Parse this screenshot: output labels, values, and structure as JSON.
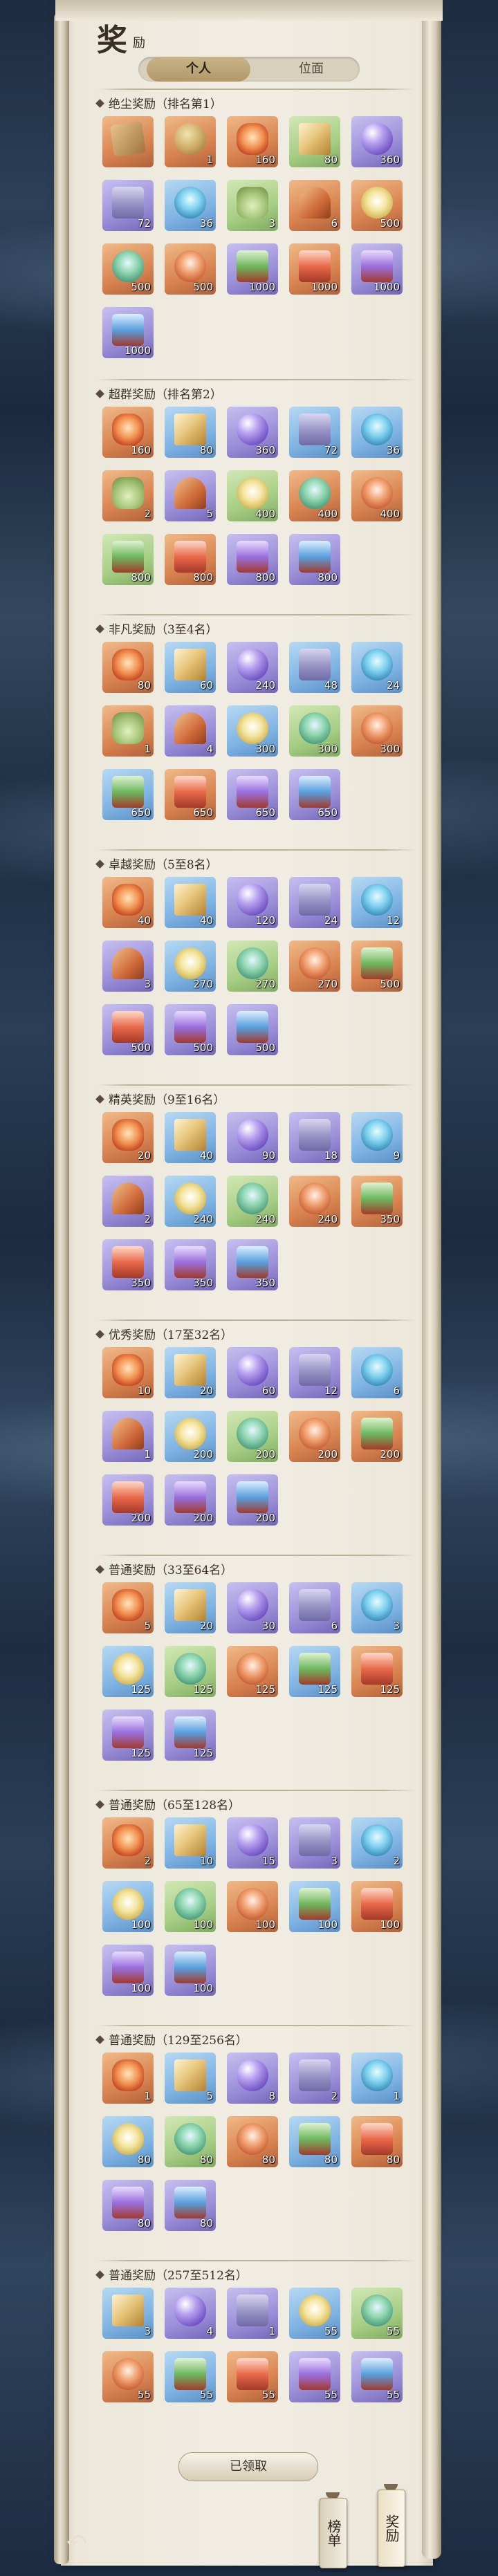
{
  "header": {
    "title": "奖",
    "subtitle": "励"
  },
  "tabs": [
    {
      "label": "个人"
    },
    {
      "label": "位面"
    }
  ],
  "sections": [
    {
      "title": "绝尘奖励（排名第1）",
      "items": [
        {
          "q": "",
          "icon": "i-tome",
          "c": "orange"
        },
        {
          "q": "1",
          "icon": "i-urn",
          "c": "orange"
        },
        {
          "q": "160",
          "icon": "i-flower",
          "c": "orange"
        },
        {
          "q": "80",
          "icon": "i-book",
          "c": "green"
        },
        {
          "q": "360",
          "icon": "i-orb",
          "c": "purple"
        },
        {
          "q": "72",
          "icon": "i-chest",
          "c": "purple"
        },
        {
          "q": "36",
          "icon": "i-bluefire",
          "c": "blue"
        },
        {
          "q": "3",
          "icon": "i-hat",
          "c": "green"
        },
        {
          "q": "6",
          "icon": "i-fan",
          "c": "orange"
        },
        {
          "q": "500",
          "icon": "i-silkgold",
          "c": "orange"
        },
        {
          "q": "500",
          "icon": "i-bowlgreen",
          "c": "orange"
        },
        {
          "q": "500",
          "icon": "i-bowlred",
          "c": "orange"
        },
        {
          "q": "1000",
          "icon": "i-boxgreen",
          "c": "purple"
        },
        {
          "q": "1000",
          "icon": "i-boxred",
          "c": "orange"
        },
        {
          "q": "1000",
          "icon": "i-boxpurple",
          "c": "purple"
        },
        {
          "q": "1000",
          "icon": "i-boxblue",
          "c": "purple"
        }
      ]
    },
    {
      "title": "超群奖励（排名第2）",
      "items": [
        {
          "q": "160",
          "icon": "i-flower",
          "c": "orange"
        },
        {
          "q": "80",
          "icon": "i-book",
          "c": "blue"
        },
        {
          "q": "360",
          "icon": "i-orb",
          "c": "purple"
        },
        {
          "q": "72",
          "icon": "i-chest",
          "c": "blue"
        },
        {
          "q": "36",
          "icon": "i-bluefire",
          "c": "blue"
        },
        {
          "q": "2",
          "icon": "i-hat",
          "c": "orange"
        },
        {
          "q": "5",
          "icon": "i-fan",
          "c": "purple"
        },
        {
          "q": "400",
          "icon": "i-silkgold",
          "c": "green"
        },
        {
          "q": "400",
          "icon": "i-bowlgreen",
          "c": "orange"
        },
        {
          "q": "400",
          "icon": "i-bowlred",
          "c": "orange"
        },
        {
          "q": "800",
          "icon": "i-boxgreen",
          "c": "green"
        },
        {
          "q": "800",
          "icon": "i-boxred",
          "c": "orange"
        },
        {
          "q": "800",
          "icon": "i-boxpurple",
          "c": "purple"
        },
        {
          "q": "800",
          "icon": "i-boxblue",
          "c": "purple"
        }
      ]
    },
    {
      "title": "非凡奖励（3至4名）",
      "items": [
        {
          "q": "80",
          "icon": "i-flower",
          "c": "orange"
        },
        {
          "q": "60",
          "icon": "i-book",
          "c": "blue"
        },
        {
          "q": "240",
          "icon": "i-orb",
          "c": "purple"
        },
        {
          "q": "48",
          "icon": "i-chest",
          "c": "blue"
        },
        {
          "q": "24",
          "icon": "i-bluefire",
          "c": "blue"
        },
        {
          "q": "1",
          "icon": "i-hat",
          "c": "orange"
        },
        {
          "q": "4",
          "icon": "i-fan",
          "c": "purple"
        },
        {
          "q": "300",
          "icon": "i-silkgold",
          "c": "blue"
        },
        {
          "q": "300",
          "icon": "i-bowlgreen",
          "c": "green"
        },
        {
          "q": "300",
          "icon": "i-bowlred",
          "c": "orange"
        },
        {
          "q": "650",
          "icon": "i-boxgreen",
          "c": "blue"
        },
        {
          "q": "650",
          "icon": "i-boxred",
          "c": "orange"
        },
        {
          "q": "650",
          "icon": "i-boxpurple",
          "c": "purple"
        },
        {
          "q": "650",
          "icon": "i-boxblue",
          "c": "purple"
        }
      ]
    },
    {
      "title": "卓越奖励（5至8名）",
      "items": [
        {
          "q": "40",
          "icon": "i-flower",
          "c": "orange"
        },
        {
          "q": "40",
          "icon": "i-book",
          "c": "blue"
        },
        {
          "q": "120",
          "icon": "i-orb",
          "c": "purple"
        },
        {
          "q": "24",
          "icon": "i-chest",
          "c": "purple"
        },
        {
          "q": "12",
          "icon": "i-bluefire",
          "c": "blue"
        },
        {
          "q": "3",
          "icon": "i-fan",
          "c": "purple"
        },
        {
          "q": "270",
          "icon": "i-silkgold",
          "c": "blue"
        },
        {
          "q": "270",
          "icon": "i-bowlgreen",
          "c": "green"
        },
        {
          "q": "270",
          "icon": "i-bowlred",
          "c": "orange"
        },
        {
          "q": "500",
          "icon": "i-boxgreen",
          "c": "orange"
        },
        {
          "q": "500",
          "icon": "i-boxred",
          "c": "purple"
        },
        {
          "q": "500",
          "icon": "i-boxpurple",
          "c": "purple"
        },
        {
          "q": "500",
          "icon": "i-boxblue",
          "c": "purple"
        }
      ]
    },
    {
      "title": "精英奖励（9至16名）",
      "items": [
        {
          "q": "20",
          "icon": "i-flower",
          "c": "orange"
        },
        {
          "q": "40",
          "icon": "i-book",
          "c": "blue"
        },
        {
          "q": "90",
          "icon": "i-orb",
          "c": "purple"
        },
        {
          "q": "18",
          "icon": "i-chest",
          "c": "purple"
        },
        {
          "q": "9",
          "icon": "i-bluefire",
          "c": "blue"
        },
        {
          "q": "2",
          "icon": "i-fan",
          "c": "purple"
        },
        {
          "q": "240",
          "icon": "i-silkgold",
          "c": "blue"
        },
        {
          "q": "240",
          "icon": "i-bowlgreen",
          "c": "green"
        },
        {
          "q": "240",
          "icon": "i-bowlred",
          "c": "orange"
        },
        {
          "q": "350",
          "icon": "i-boxgreen",
          "c": "orange"
        },
        {
          "q": "350",
          "icon": "i-boxred",
          "c": "purple"
        },
        {
          "q": "350",
          "icon": "i-boxpurple",
          "c": "purple"
        },
        {
          "q": "350",
          "icon": "i-boxblue",
          "c": "purple"
        }
      ]
    },
    {
      "title": "优秀奖励（17至32名）",
      "items": [
        {
          "q": "10",
          "icon": "i-flower",
          "c": "orange"
        },
        {
          "q": "20",
          "icon": "i-book",
          "c": "blue"
        },
        {
          "q": "60",
          "icon": "i-orb",
          "c": "purple"
        },
        {
          "q": "12",
          "icon": "i-chest",
          "c": "purple"
        },
        {
          "q": "6",
          "icon": "i-bluefire",
          "c": "blue"
        },
        {
          "q": "1",
          "icon": "i-fan",
          "c": "purple"
        },
        {
          "q": "200",
          "icon": "i-silkgold",
          "c": "blue"
        },
        {
          "q": "200",
          "icon": "i-bowlgreen",
          "c": "green"
        },
        {
          "q": "200",
          "icon": "i-bowlred",
          "c": "orange"
        },
        {
          "q": "200",
          "icon": "i-boxgreen",
          "c": "orange"
        },
        {
          "q": "200",
          "icon": "i-boxred",
          "c": "purple"
        },
        {
          "q": "200",
          "icon": "i-boxpurple",
          "c": "purple"
        },
        {
          "q": "200",
          "icon": "i-boxblue",
          "c": "purple"
        }
      ]
    },
    {
      "title": "普通奖励（33至64名）",
      "items": [
        {
          "q": "5",
          "icon": "i-flower",
          "c": "orange"
        },
        {
          "q": "20",
          "icon": "i-book",
          "c": "blue"
        },
        {
          "q": "30",
          "icon": "i-orb",
          "c": "purple"
        },
        {
          "q": "6",
          "icon": "i-chest",
          "c": "purple"
        },
        {
          "q": "3",
          "icon": "i-bluefire",
          "c": "blue"
        },
        {
          "q": "125",
          "icon": "i-silkgold",
          "c": "blue"
        },
        {
          "q": "125",
          "icon": "i-bowlgreen",
          "c": "green"
        },
        {
          "q": "125",
          "icon": "i-bowlred",
          "c": "orange"
        },
        {
          "q": "125",
          "icon": "i-boxgreen",
          "c": "blue"
        },
        {
          "q": "125",
          "icon": "i-boxred",
          "c": "orange"
        },
        {
          "q": "125",
          "icon": "i-boxpurple",
          "c": "purple"
        },
        {
          "q": "125",
          "icon": "i-boxblue",
          "c": "purple"
        }
      ]
    },
    {
      "title": "普通奖励（65至128名）",
      "items": [
        {
          "q": "2",
          "icon": "i-flower",
          "c": "orange"
        },
        {
          "q": "10",
          "icon": "i-book",
          "c": "blue"
        },
        {
          "q": "15",
          "icon": "i-orb",
          "c": "purple"
        },
        {
          "q": "3",
          "icon": "i-chest",
          "c": "purple"
        },
        {
          "q": "2",
          "icon": "i-bluefire",
          "c": "blue"
        },
        {
          "q": "100",
          "icon": "i-silkgold",
          "c": "blue"
        },
        {
          "q": "100",
          "icon": "i-bowlgreen",
          "c": "green"
        },
        {
          "q": "100",
          "icon": "i-bowlred",
          "c": "orange"
        },
        {
          "q": "100",
          "icon": "i-boxgreen",
          "c": "blue"
        },
        {
          "q": "100",
          "icon": "i-boxred",
          "c": "orange"
        },
        {
          "q": "100",
          "icon": "i-boxpurple",
          "c": "purple"
        },
        {
          "q": "100",
          "icon": "i-boxblue",
          "c": "purple"
        }
      ]
    },
    {
      "title": "普通奖励（129至256名）",
      "items": [
        {
          "q": "1",
          "icon": "i-flower",
          "c": "orange"
        },
        {
          "q": "5",
          "icon": "i-book",
          "c": "blue"
        },
        {
          "q": "8",
          "icon": "i-orb",
          "c": "purple"
        },
        {
          "q": "2",
          "icon": "i-chest",
          "c": "purple"
        },
        {
          "q": "1",
          "icon": "i-bluefire",
          "c": "blue"
        },
        {
          "q": "80",
          "icon": "i-silkgold",
          "c": "blue"
        },
        {
          "q": "80",
          "icon": "i-bowlgreen",
          "c": "green"
        },
        {
          "q": "80",
          "icon": "i-bowlred",
          "c": "orange"
        },
        {
          "q": "80",
          "icon": "i-boxgreen",
          "c": "blue"
        },
        {
          "q": "80",
          "icon": "i-boxred",
          "c": "orange"
        },
        {
          "q": "80",
          "icon": "i-boxpurple",
          "c": "purple"
        },
        {
          "q": "80",
          "icon": "i-boxblue",
          "c": "purple"
        }
      ]
    },
    {
      "title": "普通奖励（257至512名）",
      "items": [
        {
          "q": "3",
          "icon": "i-book",
          "c": "blue"
        },
        {
          "q": "4",
          "icon": "i-orb",
          "c": "purple"
        },
        {
          "q": "1",
          "icon": "i-chest",
          "c": "purple"
        },
        {
          "q": "55",
          "icon": "i-silkgold",
          "c": "blue"
        },
        {
          "q": "55",
          "icon": "i-bowlgreen",
          "c": "green"
        },
        {
          "q": "55",
          "icon": "i-bowlred",
          "c": "orange"
        },
        {
          "q": "55",
          "icon": "i-boxgreen",
          "c": "blue"
        },
        {
          "q": "55",
          "icon": "i-boxred",
          "c": "orange"
        },
        {
          "q": "55",
          "icon": "i-boxpurple",
          "c": "purple"
        },
        {
          "q": "55",
          "icon": "i-boxblue",
          "c": "purple"
        }
      ]
    }
  ],
  "claim_button": "已领取",
  "side_tabs": {
    "rank": "榜单",
    "reward": "奖励"
  },
  "icons": {
    "back": "back-arrow-icon"
  }
}
